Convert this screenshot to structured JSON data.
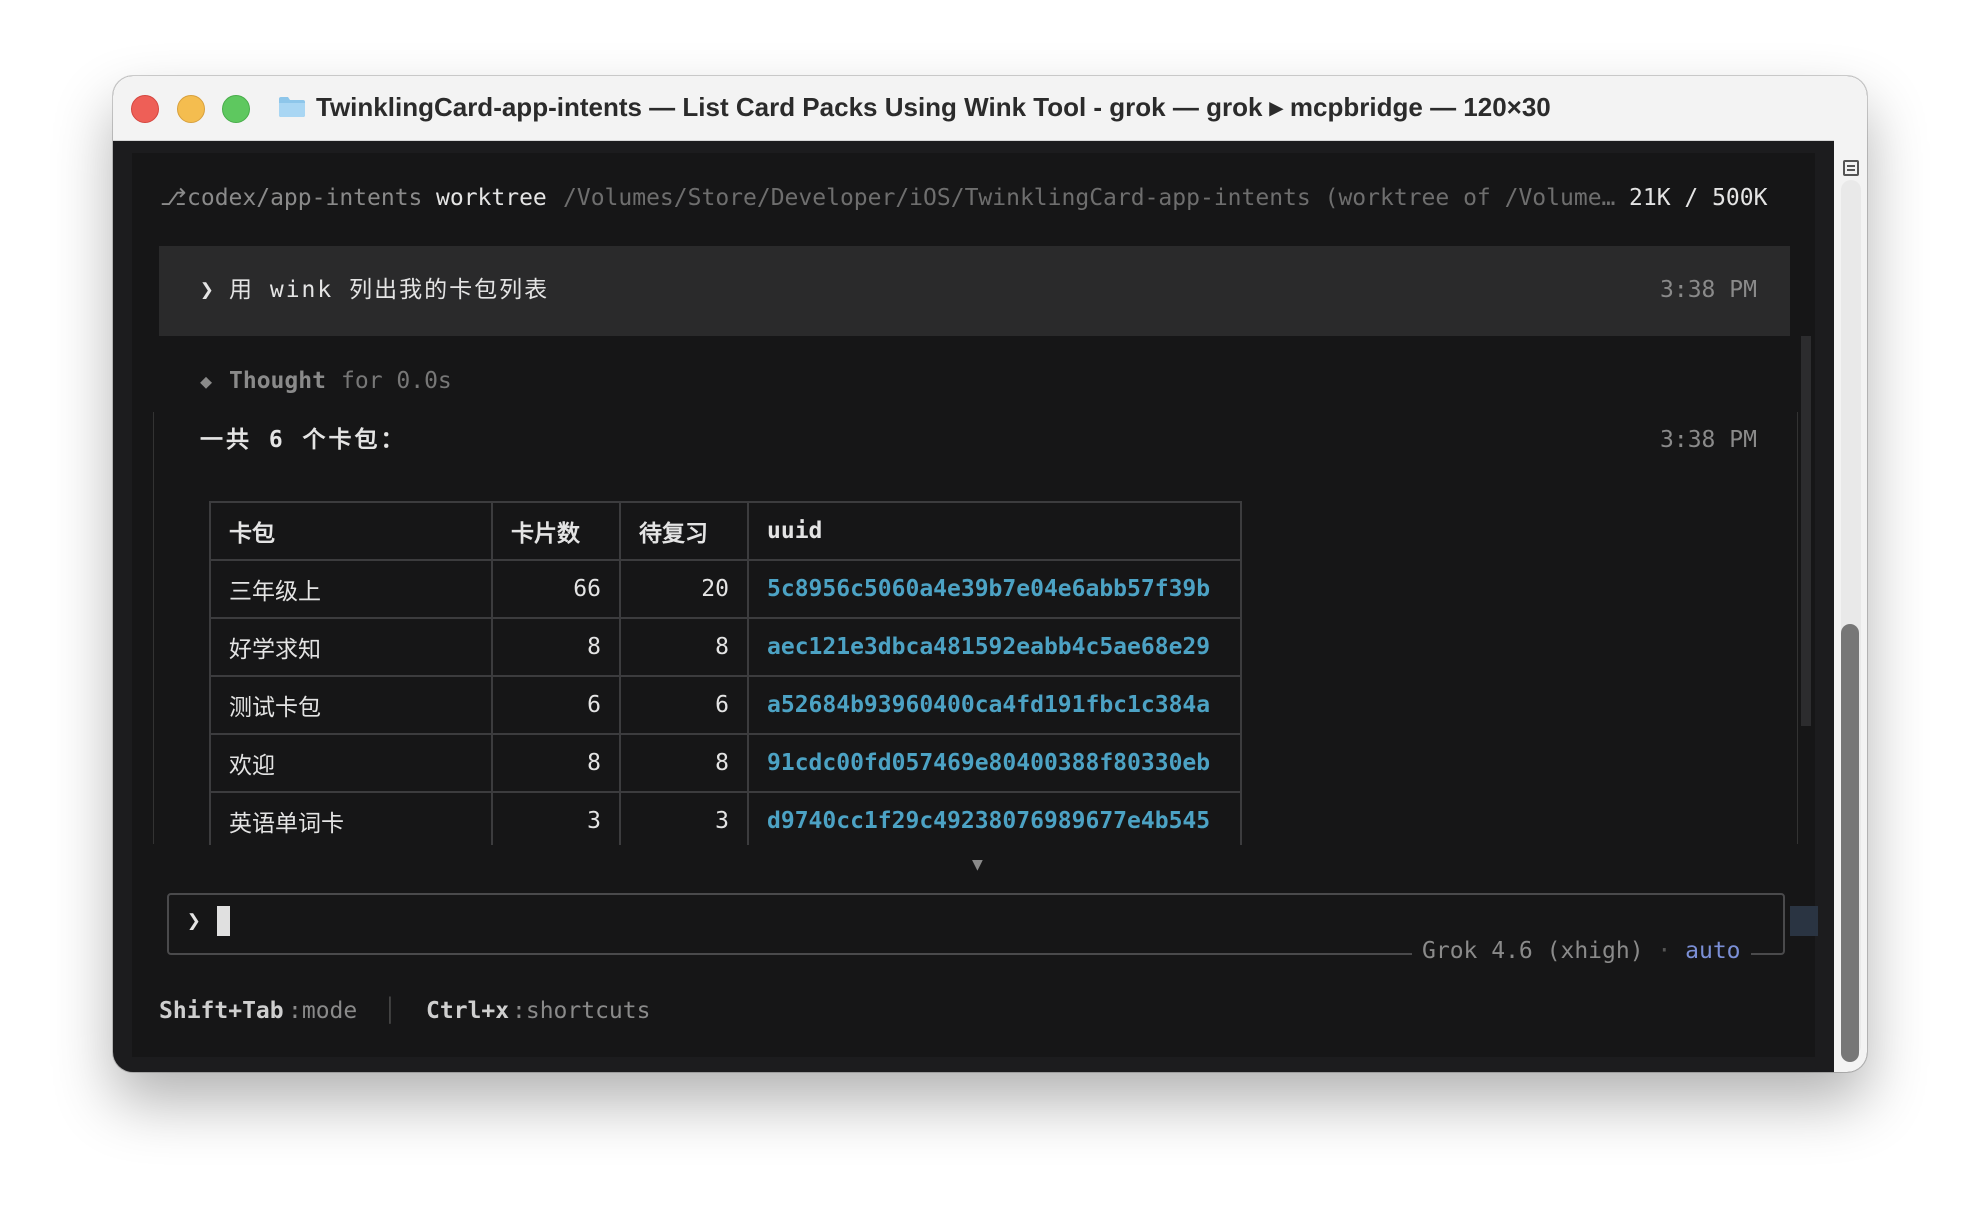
{
  "window": {
    "title": "TwinklingCard-app-intents — List Card Packs Using Wink Tool - grok — grok ▸ mcpbridge — 120×30"
  },
  "status_line": {
    "branch_glyph": "⎇",
    "branch": "codex/app-intents",
    "mode": "worktree",
    "path": "/Volumes/Store/Developer/iOS/TwinklingCard-app-intents (worktree of /Volume…",
    "tokens": "21K / 500K"
  },
  "user_prompt": {
    "marker": "❯",
    "text": "用 wink 列出我的卡包列表",
    "time": "3:38 PM"
  },
  "thought": {
    "marker": "◆",
    "label": "Thought",
    "detail": "for 0.0s"
  },
  "response": {
    "summary": "一共 6 个卡包：",
    "time": "3:38 PM",
    "table": {
      "headers": [
        "卡包",
        "卡片数",
        "待复习",
        "uuid"
      ],
      "rows": [
        {
          "name": "三年级上",
          "cards": "66",
          "due": "20",
          "uuid": "5c8956c5060a4e39b7e04e6abb57f39b"
        },
        {
          "name": "好学求知",
          "cards": "8",
          "due": "8",
          "uuid": "aec121e3dbca481592eabb4c5ae68e29"
        },
        {
          "name": "测试卡包",
          "cards": "6",
          "due": "6",
          "uuid": "a52684b93960400ca4fd191fbc1c384a"
        },
        {
          "name": "欢迎",
          "cards": "8",
          "due": "8",
          "uuid": "91cdc00fd057469e80400388f80330eb"
        },
        {
          "name": "英语单词卡",
          "cards": "3",
          "due": "3",
          "uuid": "d9740cc1f29c49238076989677e4b545"
        }
      ]
    },
    "more_indicator": "▼"
  },
  "input": {
    "marker": "❯",
    "model": "Grok 4.6 (xhigh)",
    "separator": "·",
    "permission": "auto"
  },
  "footer": {
    "shortcut1_key": "Shift+Tab",
    "shortcut1_action": ":mode",
    "divider": "│",
    "shortcut2_key": "Ctrl+x",
    "shortcut2_action": ":shortcuts"
  },
  "colors": {
    "accent_link": "#4ca2c4",
    "permission": "#7b8fd6",
    "background": "#161617"
  }
}
